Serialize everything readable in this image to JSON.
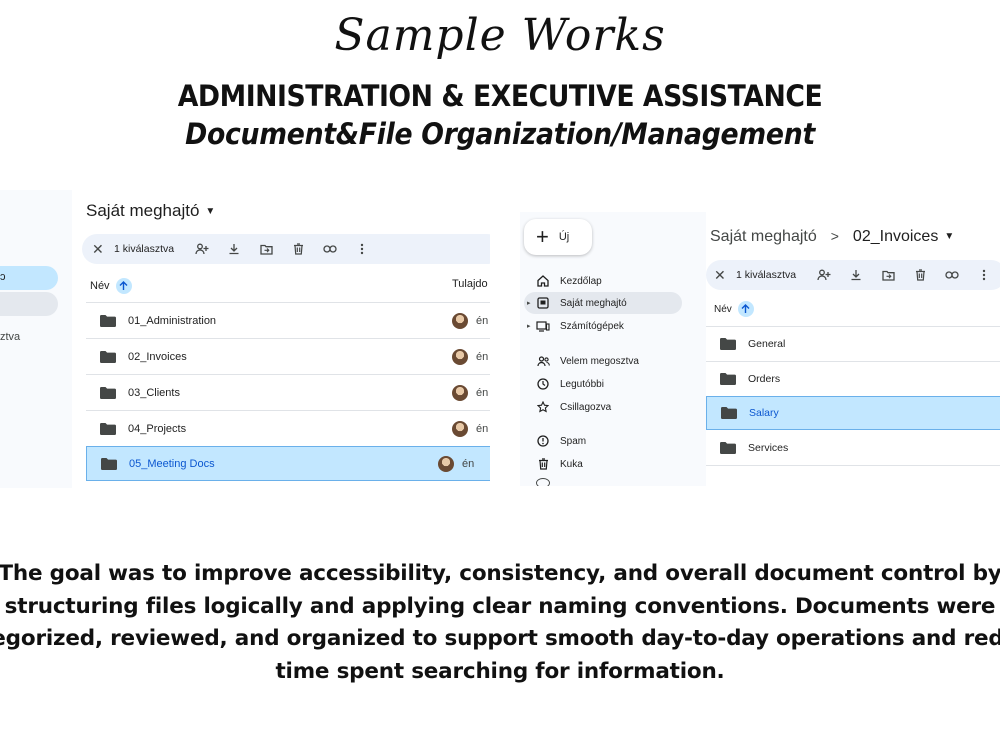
{
  "header": {
    "script_title": "Sample Works",
    "main_title": "ADMINISTRATION & EXECUTIVE ASSISTANCE",
    "subtitle": "Document&File Organization/Management"
  },
  "screenshot_left": {
    "sidebar": {
      "active_glyph": "ɔ",
      "fragment_label": "ztva"
    },
    "breadcrumb": "Saját meghajtó",
    "selection_bar": {
      "count_label": "1 kiválasztva",
      "tools": [
        "close-icon",
        "share-icon",
        "download-icon",
        "move-icon",
        "trash-icon",
        "link-icon",
        "more-icon"
      ]
    },
    "columns": {
      "name": "Név",
      "owner": "Tulajdo"
    },
    "rows": [
      {
        "name": "01_Administration",
        "owner": "én",
        "selected": false
      },
      {
        "name": "02_Invoices",
        "owner": "én",
        "selected": false
      },
      {
        "name": "03_Clients",
        "owner": "én",
        "selected": false
      },
      {
        "name": "04_Projects",
        "owner": "én",
        "selected": false
      },
      {
        "name": "05_Meeting Docs",
        "owner": "én",
        "selected": true
      }
    ]
  },
  "screenshot_right": {
    "new_button": "Új",
    "nav": [
      {
        "label": "Kezdőlap",
        "icon": "home-icon"
      },
      {
        "label": "Saját meghajtó",
        "icon": "drive-icon"
      },
      {
        "label": "Számítógépek",
        "icon": "computer-icon"
      },
      {
        "label": "Velem megosztva",
        "icon": "shared-icon"
      },
      {
        "label": "Legutóbbi",
        "icon": "clock-icon"
      },
      {
        "label": "Csillagozva",
        "icon": "star-icon"
      },
      {
        "label": "Spam",
        "icon": "spam-icon"
      },
      {
        "label": "Kuka",
        "icon": "trash-icon"
      }
    ],
    "breadcrumb": {
      "parent": "Saját meghajtó",
      "current": "02_Invoices"
    },
    "selection_bar": {
      "count_label": "1 kiválasztva"
    },
    "columns": {
      "name": "Név"
    },
    "rows": [
      {
        "name": "General",
        "selected": false
      },
      {
        "name": "Orders",
        "selected": false
      },
      {
        "name": "Salary",
        "selected": true
      },
      {
        "name": "Services",
        "selected": false
      }
    ]
  },
  "description": "The goal was to improve accessibility, consistency, and overall document control by structuring files logically and applying clear naming conventions. Documents were categorized, reviewed, and organized to support smooth day-to-day operations and reduce time spent searching for information."
}
